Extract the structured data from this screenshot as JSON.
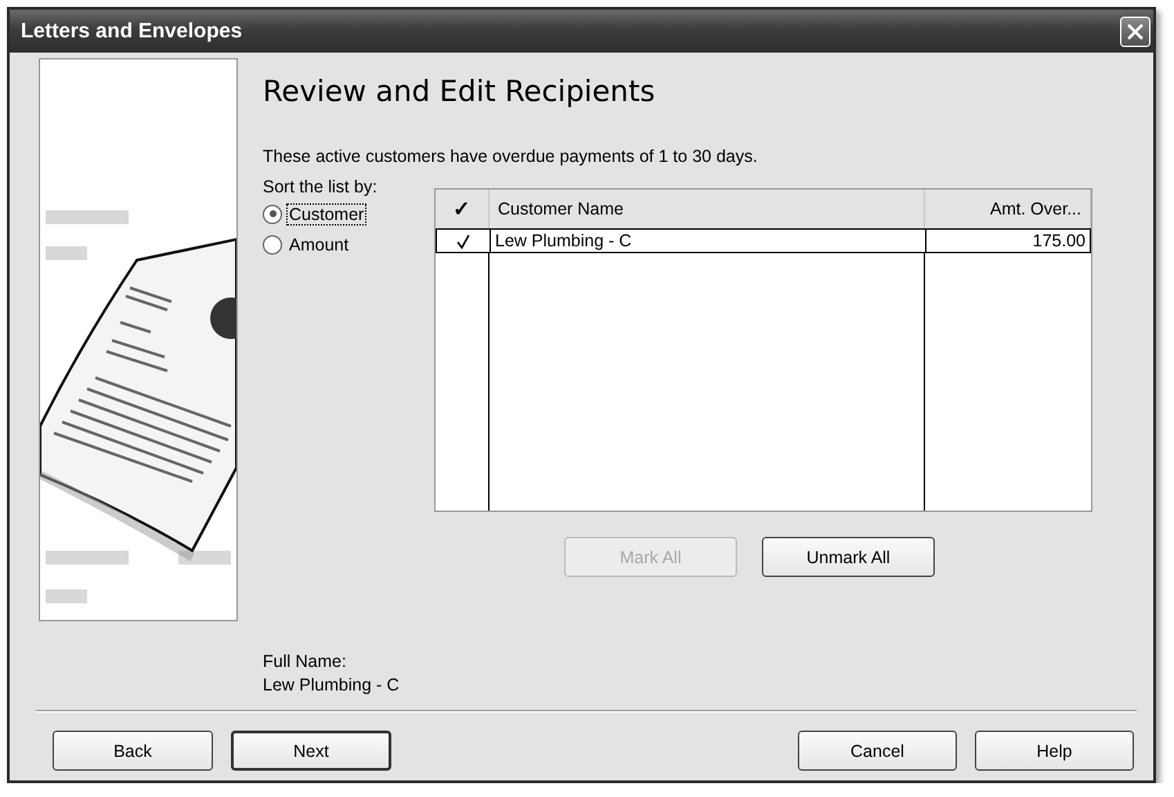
{
  "window": {
    "title": "Letters and Envelopes"
  },
  "heading": "Review and Edit Recipients",
  "description": "These active customers have overdue payments of 1 to 30 days.",
  "sort": {
    "label": "Sort the list by:",
    "options": [
      {
        "label": "Customer",
        "selected": true,
        "focused": true
      },
      {
        "label": "Amount",
        "selected": false,
        "focused": false
      }
    ]
  },
  "table": {
    "columns": [
      {
        "label": "✓"
      },
      {
        "label": "Customer Name"
      },
      {
        "label": "Amt. Over..."
      }
    ],
    "rows": [
      {
        "checked": true,
        "customer_name": "Lew Plumbing - C",
        "amount": "175.00",
        "selected": true
      }
    ]
  },
  "list_buttons": [
    {
      "label": "Mark All",
      "disabled": true
    },
    {
      "label": "Unmark All",
      "disabled": false
    }
  ],
  "full_name": {
    "label": "Full Name:",
    "value": "Lew Plumbing - C"
  },
  "navigation_buttons": [
    {
      "label": "Back",
      "default": false
    },
    {
      "label": "Next",
      "default": true
    }
  ],
  "action_buttons": [
    {
      "label": "Cancel",
      "default": false
    },
    {
      "label": "Help",
      "default": false
    }
  ]
}
